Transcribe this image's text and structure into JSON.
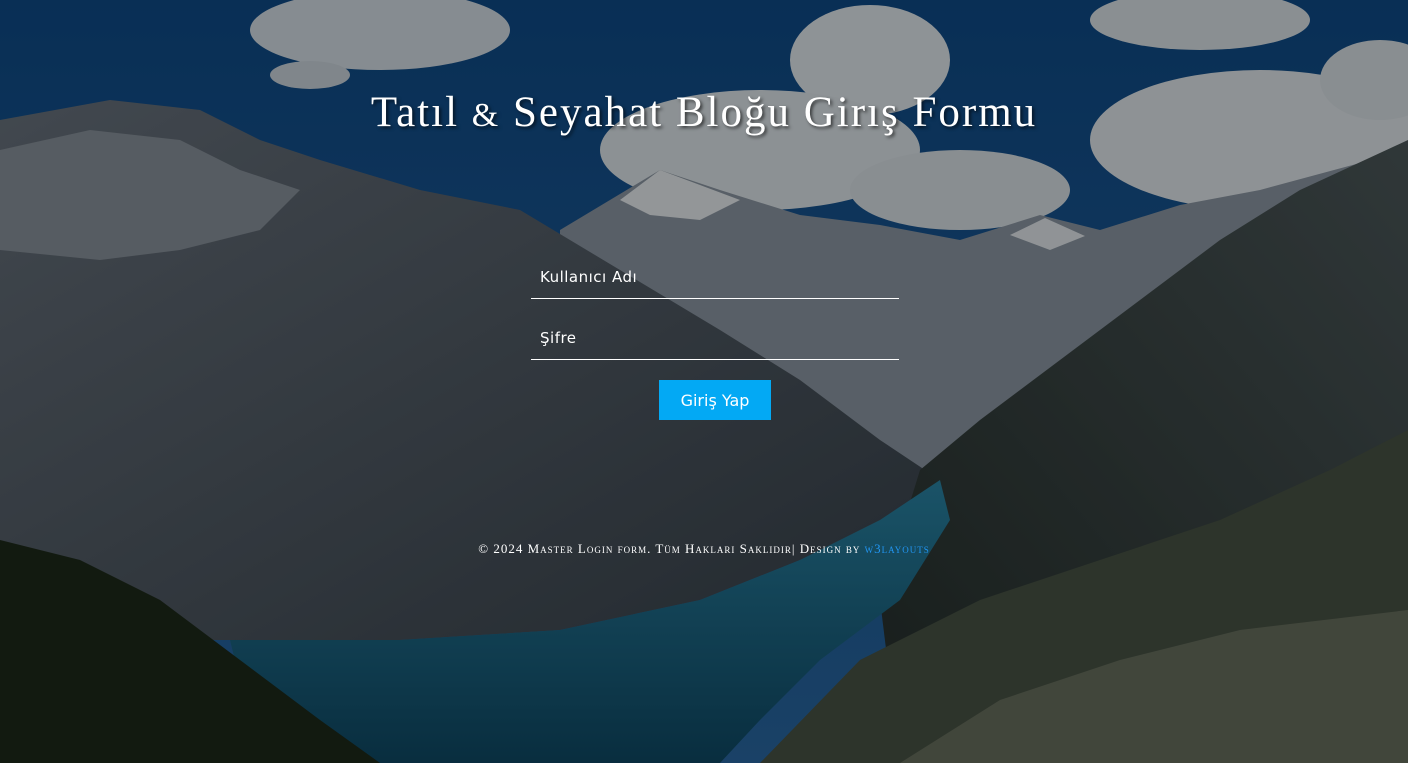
{
  "page": {
    "title_part1": "Tatıl",
    "title_amp": "&",
    "title_part2": "Seyahat Bloğu Girış Formu"
  },
  "form": {
    "username_placeholder": "Kullanıcı Adı",
    "password_placeholder": "Şifre",
    "submit_label": "Giriş Yap"
  },
  "footer": {
    "text": "© 2024 Master Login form. Tüm Hakları Saklıdır| Design by ",
    "link_text": "w3layouts"
  },
  "colors": {
    "accent": "#03a9f4",
    "link": "#2196f3",
    "text": "#ffffff"
  }
}
